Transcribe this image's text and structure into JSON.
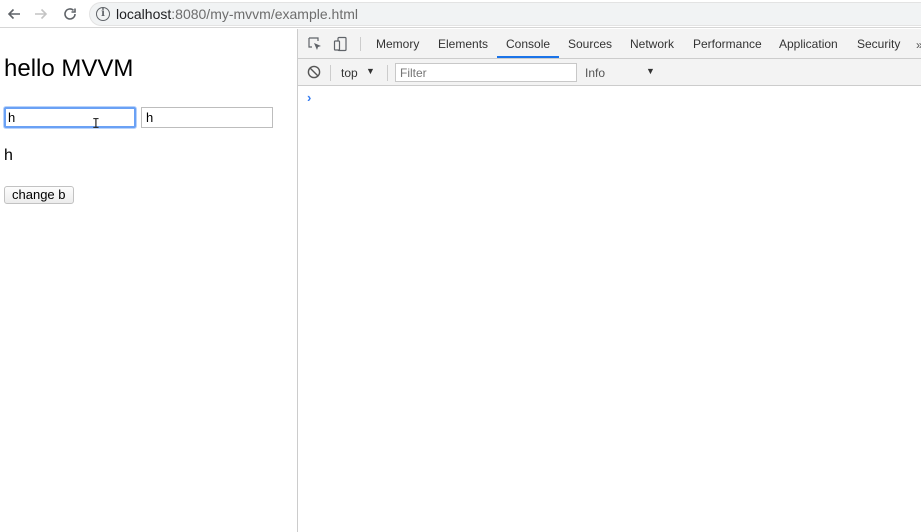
{
  "browser": {
    "url_host": "localhost",
    "url_rest": ":8080/my-mvvm/example.html",
    "info_glyph": "i",
    "icons": [
      "back-arrow-icon",
      "forward-arrow-icon",
      "reload-icon",
      "info-icon"
    ]
  },
  "page": {
    "title": "hello MVVM",
    "input_a_value": "h",
    "input_b_value": "h",
    "mirror_text": "h",
    "change_button_label": "change b",
    "text_cursor_glyph": "I"
  },
  "devtools": {
    "tabs": [
      {
        "label": "Memory"
      },
      {
        "label": "Elements"
      },
      {
        "label": "Console"
      },
      {
        "label": "Sources"
      },
      {
        "label": "Network"
      },
      {
        "label": "Performance"
      },
      {
        "label": "Application"
      },
      {
        "label": "Security"
      }
    ],
    "active_tab": "Console",
    "more_glyph": "»",
    "context": "top",
    "filter_placeholder": "Filter",
    "level": "Info",
    "dropdown_glyph": "▼",
    "prompt_glyph": "›",
    "accent_color": "#1a73e8"
  }
}
